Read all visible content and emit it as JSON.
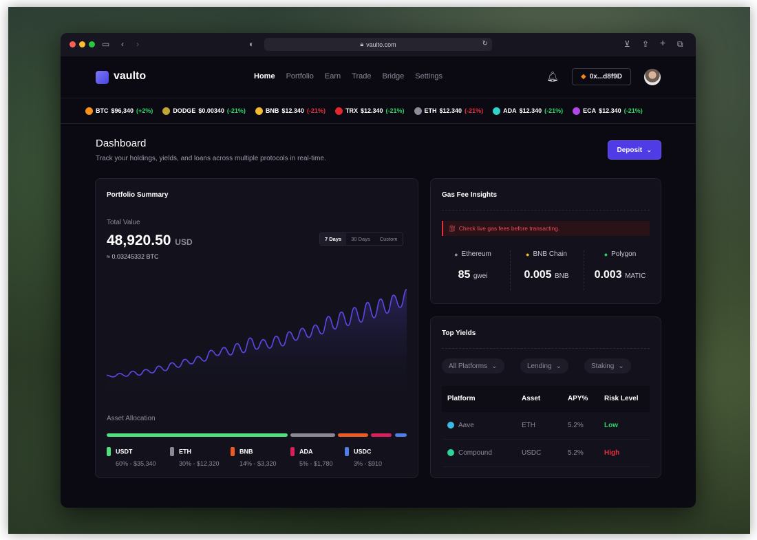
{
  "browser": {
    "url": "vaulto.com"
  },
  "brand": {
    "name": "vaulto"
  },
  "nav": {
    "items": [
      "Home",
      "Portfolio",
      "Earn",
      "Trade",
      "Bridge",
      "Settings"
    ],
    "active": "Home"
  },
  "wallet": {
    "address": "0x...d8f9D"
  },
  "ticker": [
    {
      "symbol": "BTC",
      "price": "$96,340",
      "change": "(+2%)",
      "color": "#f7931a",
      "change_color": "#2fd46b"
    },
    {
      "symbol": "DODGE",
      "price": "$0.00340",
      "change": "(-21%)",
      "color": "#c2a633",
      "change_color": "#2fd46b"
    },
    {
      "symbol": "BNB",
      "price": "$12.340",
      "change": "(-21%)",
      "color": "#f3ba2f",
      "change_color": "#e2323e"
    },
    {
      "symbol": "TRX",
      "price": "$12.340",
      "change": "(-21%)",
      "color": "#e5262d",
      "change_color": "#2fd46b"
    },
    {
      "symbol": "ETH",
      "price": "$12.340",
      "change": "(-21%)",
      "color": "#8b8b9a",
      "change_color": "#e2323e"
    },
    {
      "symbol": "ADA",
      "price": "$12.340",
      "change": "(-21%)",
      "color": "#2fd4c6",
      "change_color": "#2fd46b"
    },
    {
      "symbol": "ECA",
      "price": "$12.340",
      "change": "(-21%)",
      "color": "#b048e8",
      "change_color": "#2fd46b"
    }
  ],
  "dashboard": {
    "title": "Dashboard",
    "subtitle": "Track your holdings, yields, and loans across multiple protocols in real-time.",
    "deposit_label": "Deposit"
  },
  "portfolio": {
    "title": "Portfolio Summary",
    "total_label": "Total Value",
    "total_value": "48,920.50",
    "total_unit": "USD",
    "btc_value": "≈ 0.03245332 BTC",
    "ranges": [
      "7 Days",
      "30 Days",
      "Custom"
    ],
    "active_range": "7 Days",
    "chart_data": {
      "type": "area",
      "y": [
        30,
        27,
        33,
        28,
        37,
        30,
        40,
        34,
        46,
        38,
        52,
        44,
        58,
        50,
        63,
        55,
        74,
        65,
        79,
        66,
        86,
        70,
        96,
        76,
        93,
        78,
        99,
        82,
        107,
        92,
        113,
        97,
        119,
        103,
        134,
        112,
        142,
        118,
        150,
        124,
        159,
        132,
        165,
        140,
        172,
        150,
        182
      ],
      "line_color": "#5a48e6"
    },
    "allocation_label": "Asset Allocation",
    "allocation": [
      {
        "name": "USDT",
        "detail": "60% - $35,340",
        "share": 60,
        "color": "#4ee07e"
      },
      {
        "name": "ETH",
        "detail": "30% - $12,320",
        "share": 15,
        "color": "#8b8a93"
      },
      {
        "name": "BNB",
        "detail": "14% - $3,320",
        "share": 10,
        "color": "#ee5a24"
      },
      {
        "name": "ADA",
        "detail": "5% - $1,780",
        "share": 7,
        "color": "#d81f5c"
      },
      {
        "name": "USDC",
        "detail": "3% - $910",
        "share": 4,
        "color": "#4f7fe6"
      }
    ]
  },
  "gas": {
    "title": "Gas Fee Insights",
    "warning": "Check live gas fees before transacting.",
    "networks": [
      {
        "name": "Ethereum",
        "value": "85",
        "unit": "gwei",
        "icon_color": "#8b8b9a"
      },
      {
        "name": "BNB Chain",
        "value": "0.005",
        "unit": "BNB",
        "icon_color": "#f3ba2f"
      },
      {
        "name": "Polygon",
        "value": "0.003",
        "unit": "MATIC",
        "icon_color": "#2fd46b"
      }
    ]
  },
  "yields": {
    "title": "Top Yields",
    "filters": [
      "All Platforms",
      "Lending",
      "Staking"
    ],
    "columns": [
      "Platform",
      "Asset",
      "APY%",
      "Risk Level"
    ],
    "rows": [
      {
        "platform": "Aave",
        "asset": "ETH",
        "apy": "5.2%",
        "risk": "Low",
        "risk_color": "#2fd46b",
        "icon_color": "#3ab8e6"
      },
      {
        "platform": "Compound",
        "asset": "USDC",
        "apy": "5.2%",
        "risk": "High",
        "risk_color": "#e2323e",
        "icon_color": "#2fd49a"
      }
    ]
  }
}
